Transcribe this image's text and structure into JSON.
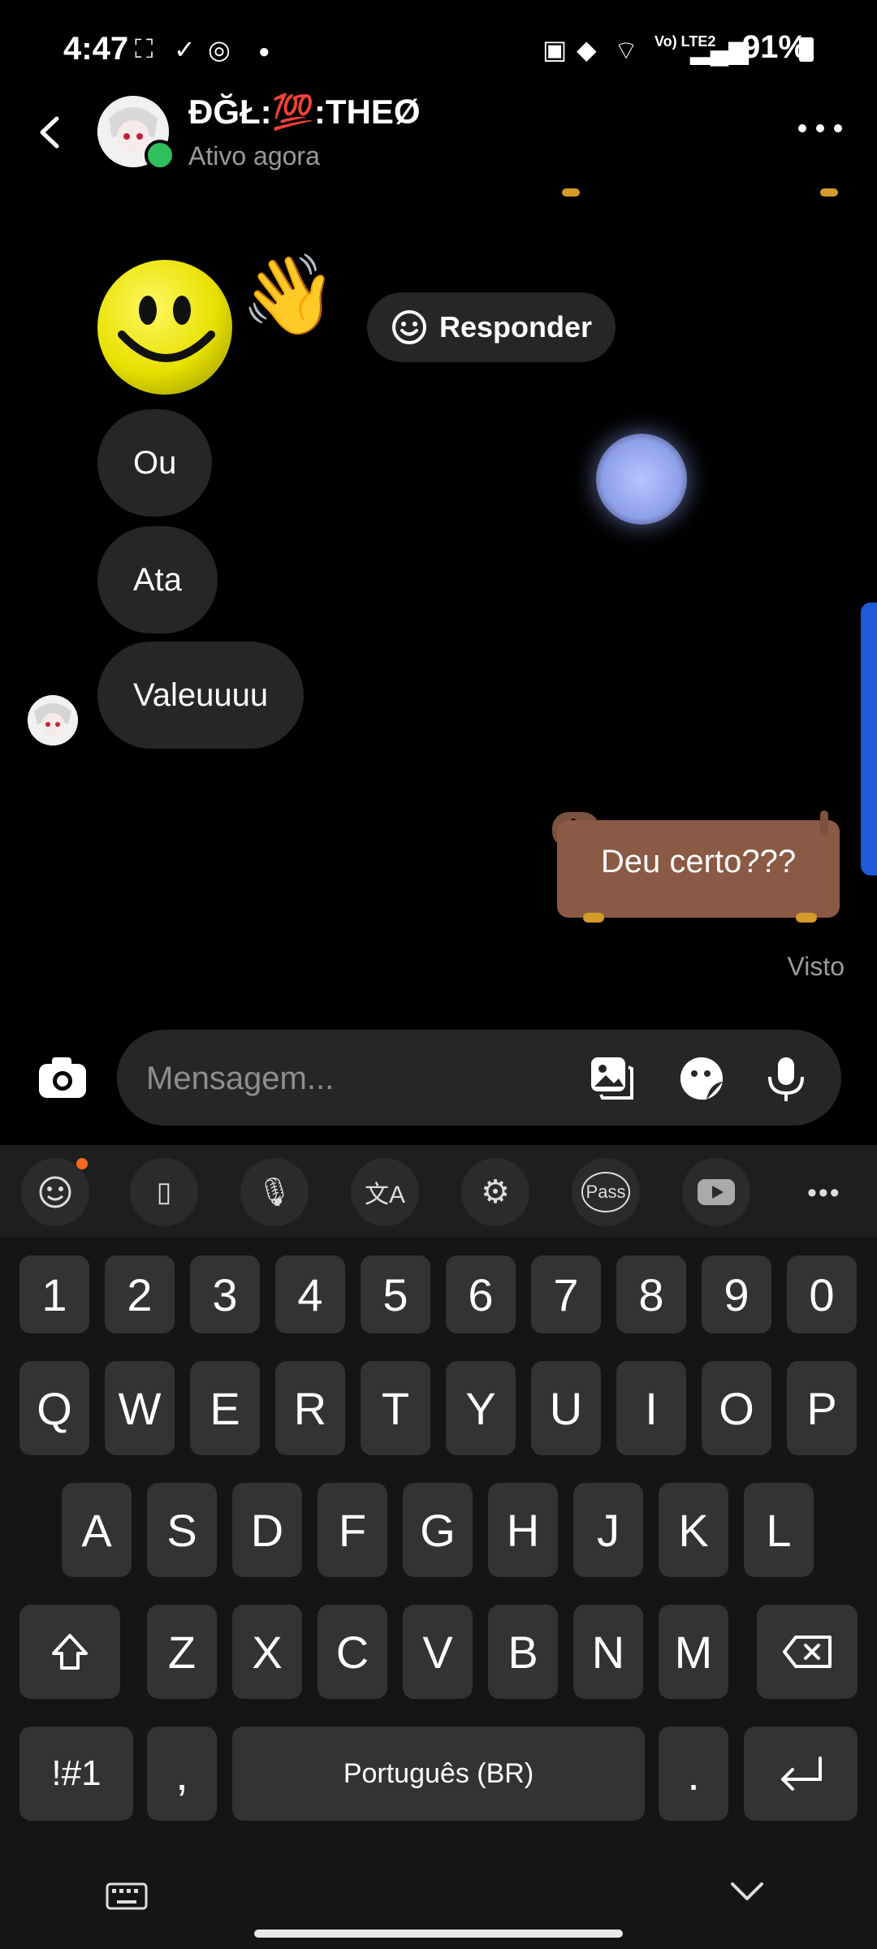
{
  "status_bar": {
    "time": "4:47",
    "battery": "91%",
    "network": "Vo) LTE2"
  },
  "header": {
    "name": "ĐĞŁ:💯:THEØ",
    "status": "Ativo agora"
  },
  "chat": {
    "reply_chip": "Responder",
    "received": [
      "Ou",
      "Ata",
      "Valeuuuu"
    ],
    "sent": "Deu certo???",
    "seen": "Visto"
  },
  "composer": {
    "placeholder": "Mensagem..."
  },
  "keyboard": {
    "toolbar": [
      "emoji",
      "clipboard",
      "mic",
      "translate",
      "settings",
      "Pass",
      "youtube",
      "more"
    ],
    "row_numbers": [
      "1",
      "2",
      "3",
      "4",
      "5",
      "6",
      "7",
      "8",
      "9",
      "0"
    ],
    "row1": [
      "Q",
      "W",
      "E",
      "R",
      "T",
      "Y",
      "U",
      "I",
      "O",
      "P"
    ],
    "row2": [
      "A",
      "S",
      "D",
      "F",
      "G",
      "H",
      "J",
      "K",
      "L"
    ],
    "row3": [
      "Z",
      "X",
      "C",
      "V",
      "B",
      "N",
      "M"
    ],
    "symbols_key": "!#1",
    "comma_key": ",",
    "space_label": "Português (BR)",
    "period_key": "."
  },
  "colors": {
    "bubble": "#262626",
    "online": "#2fbf5d",
    "accent_blue": "#1f5bd8"
  }
}
